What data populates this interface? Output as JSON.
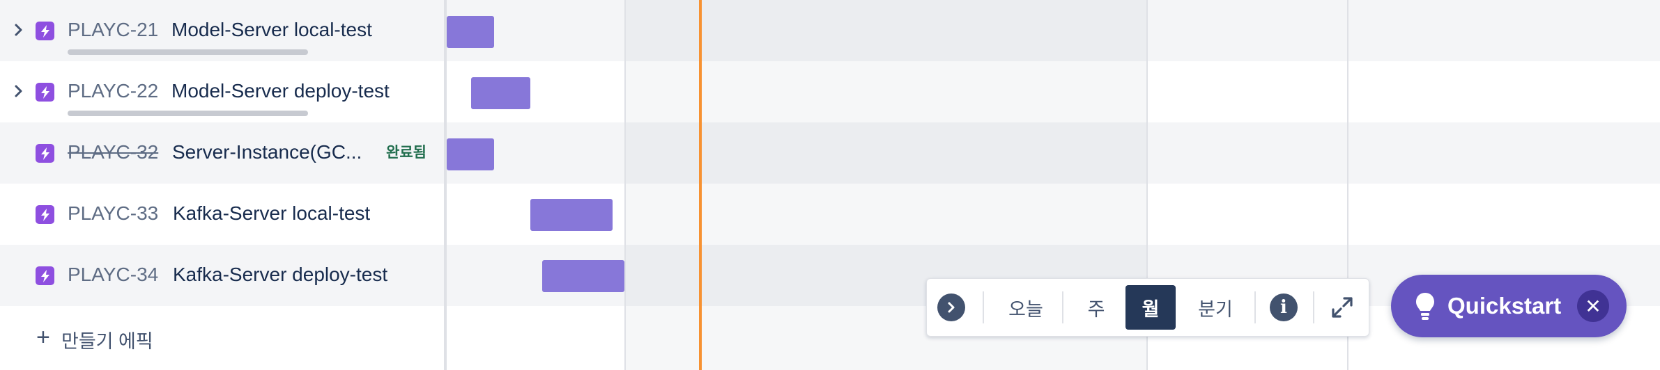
{
  "issues": [
    {
      "key": "PLAYC-21",
      "title": "Model-Server local-test",
      "expandable": true,
      "status": "",
      "progress_percent": 0
    },
    {
      "key": "PLAYC-22",
      "title": "Model-Server deploy-test",
      "expandable": true,
      "status": "",
      "progress_percent": 0
    },
    {
      "key": "PLAYC-32",
      "title": "Server-Instance(GC...",
      "expandable": false,
      "status": "완료됨"
    },
    {
      "key": "PLAYC-33",
      "title": "Kafka-Server local-test",
      "expandable": false,
      "status": ""
    },
    {
      "key": "PLAYC-34",
      "title": "Kafka-Server deploy-test",
      "expandable": false,
      "status": ""
    }
  ],
  "create_epic_label": "만들기 에픽",
  "toolbar": {
    "today_label": "오늘",
    "week_label": "주",
    "month_label": "월",
    "quarter_label": "분기",
    "active_view": "월"
  },
  "quickstart": {
    "label": "Quickstart"
  },
  "colors": {
    "epic_icon": "#8e4fe0",
    "bar": "#8777d9",
    "today_line": "#f79232",
    "quickstart_bg": "#6554c0",
    "done_lozenge_text": "#216e4e"
  }
}
